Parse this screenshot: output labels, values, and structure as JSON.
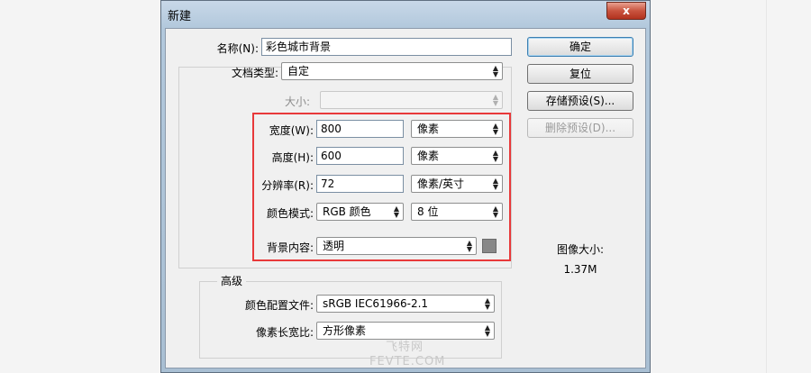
{
  "window": {
    "title": "新建",
    "close_label": "x"
  },
  "fields": {
    "name": {
      "label": "名称(N):",
      "value": "彩色城市背景"
    },
    "doc_type": {
      "label": "文档类型:",
      "value": "自定"
    },
    "size": {
      "label": "大小:",
      "value": ""
    },
    "width": {
      "label": "宽度(W):",
      "value": "800",
      "unit": "像素"
    },
    "height": {
      "label": "高度(H):",
      "value": "600",
      "unit": "像素"
    },
    "resolution": {
      "label": "分辨率(R):",
      "value": "72",
      "unit": "像素/英寸"
    },
    "color_mode": {
      "label": "颜色模式:",
      "value": "RGB 颜色",
      "depth": "8 位"
    },
    "background": {
      "label": "背景内容:",
      "value": "透明",
      "swatch_color": "#888888"
    }
  },
  "advanced": {
    "title": "高级",
    "color_profile": {
      "label": "颜色配置文件:",
      "value": "sRGB IEC61966-2.1"
    },
    "pixel_aspect": {
      "label": "像素长宽比:",
      "value": "方形像素"
    }
  },
  "buttons": {
    "ok": "确定",
    "reset": "复位",
    "save_preset": "存储预设(S)...",
    "delete_preset": "删除预设(D)..."
  },
  "image_size": {
    "label": "图像大小:",
    "value": "1.37M"
  },
  "highlight_color": "#e8393a",
  "watermark": {
    "line1": "飞特网",
    "line2": "FEVTE.COM"
  }
}
